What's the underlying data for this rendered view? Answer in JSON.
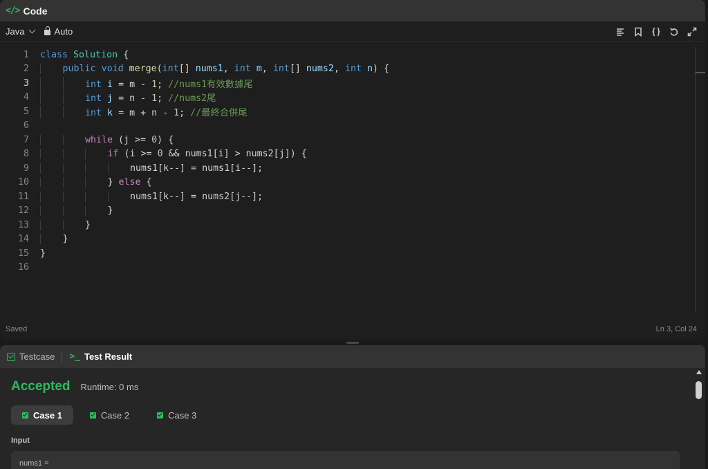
{
  "code_panel": {
    "title": "Code",
    "language": "Java",
    "mode": "Auto",
    "toolbar_icons": [
      "format-icon",
      "bookmark-icon",
      "braces-icon",
      "reset-icon",
      "expand-icon"
    ],
    "status_left": "Saved",
    "status_right": "Ln 3, Col 24"
  },
  "code_lines": [
    {
      "n": "1",
      "indent": 0,
      "tokens": [
        [
          "kw",
          "class"
        ],
        [
          "",
          " "
        ],
        [
          "cls",
          "Solution"
        ],
        [
          "",
          " {"
        ]
      ]
    },
    {
      "n": "2",
      "indent": 1,
      "tokens": [
        [
          "kw",
          "public"
        ],
        [
          "",
          " "
        ],
        [
          "kw",
          "void"
        ],
        [
          "",
          " "
        ],
        [
          "fn",
          "merge"
        ],
        [
          "",
          "("
        ],
        [
          "kw",
          "int"
        ],
        [
          "",
          "[] "
        ],
        [
          "var",
          "nums1"
        ],
        [
          "",
          ", "
        ],
        [
          "kw",
          "int"
        ],
        [
          "",
          " "
        ],
        [
          "var",
          "m"
        ],
        [
          "",
          ", "
        ],
        [
          "kw",
          "int"
        ],
        [
          "",
          "[] "
        ],
        [
          "var",
          "nums2"
        ],
        [
          "",
          ", "
        ],
        [
          "kw",
          "int"
        ],
        [
          "",
          " "
        ],
        [
          "var",
          "n"
        ],
        [
          "",
          ") {"
        ]
      ]
    },
    {
      "n": "3",
      "indent": 2,
      "tokens": [
        [
          "kw",
          "int"
        ],
        [
          "",
          " "
        ],
        [
          "var",
          "i"
        ],
        [
          "",
          " = m - "
        ],
        [
          "num",
          "1"
        ],
        [
          "",
          "; "
        ],
        [
          "cmt",
          "//nums1有效數據尾"
        ]
      ]
    },
    {
      "n": "4",
      "indent": 2,
      "tokens": [
        [
          "kw",
          "int"
        ],
        [
          "",
          " "
        ],
        [
          "var",
          "j"
        ],
        [
          "",
          " = n - "
        ],
        [
          "num",
          "1"
        ],
        [
          "",
          "; "
        ],
        [
          "cmt",
          "//nums2尾"
        ]
      ]
    },
    {
      "n": "5",
      "indent": 2,
      "tokens": [
        [
          "kw",
          "int"
        ],
        [
          "",
          " "
        ],
        [
          "var",
          "k"
        ],
        [
          "",
          " = m + n - "
        ],
        [
          "num",
          "1"
        ],
        [
          "",
          "; "
        ],
        [
          "cmt",
          "//最終合併尾"
        ]
      ]
    },
    {
      "n": "6",
      "indent": 0,
      "tokens": []
    },
    {
      "n": "7",
      "indent": 2,
      "tokens": [
        [
          "kw2",
          "while"
        ],
        [
          "",
          " (j >= "
        ],
        [
          "num",
          "0"
        ],
        [
          "",
          ") {"
        ]
      ]
    },
    {
      "n": "8",
      "indent": 3,
      "tokens": [
        [
          "kw2",
          "if"
        ],
        [
          "",
          " (i >= "
        ],
        [
          "num",
          "0"
        ],
        [
          "",
          " && nums1[i] > nums2[j]) {"
        ]
      ]
    },
    {
      "n": "9",
      "indent": 4,
      "tokens": [
        [
          "",
          "nums1[k--] = nums1[i--];"
        ]
      ]
    },
    {
      "n": "10",
      "indent": 3,
      "tokens": [
        [
          "",
          "} "
        ],
        [
          "kw2",
          "else"
        ],
        [
          "",
          " {"
        ]
      ]
    },
    {
      "n": "11",
      "indent": 4,
      "tokens": [
        [
          "",
          "nums1[k--] = nums2[j--];"
        ]
      ]
    },
    {
      "n": "12",
      "indent": 3,
      "tokens": [
        [
          "",
          "}"
        ]
      ]
    },
    {
      "n": "13",
      "indent": 2,
      "tokens": [
        [
          "",
          "}"
        ]
      ]
    },
    {
      "n": "14",
      "indent": 1,
      "tokens": [
        [
          "",
          "}"
        ]
      ]
    },
    {
      "n": "15",
      "indent": 0,
      "tokens": [
        [
          "",
          "}"
        ]
      ]
    },
    {
      "n": "16",
      "indent": 0,
      "tokens": []
    }
  ],
  "active_line": "3",
  "result_panel": {
    "tab_testcase": "Testcase",
    "tab_result": "Test Result",
    "status": "Accepted",
    "runtime": "Runtime: 0 ms",
    "cases": [
      "Case 1",
      "Case 2",
      "Case 3"
    ],
    "selected_case": 0,
    "input_label": "Input",
    "input_value": "nums1 ="
  },
  "colors": {
    "accent_green": "#2cbb5d",
    "panel_bg": "#1e1e1e",
    "header_bg": "#333333"
  }
}
